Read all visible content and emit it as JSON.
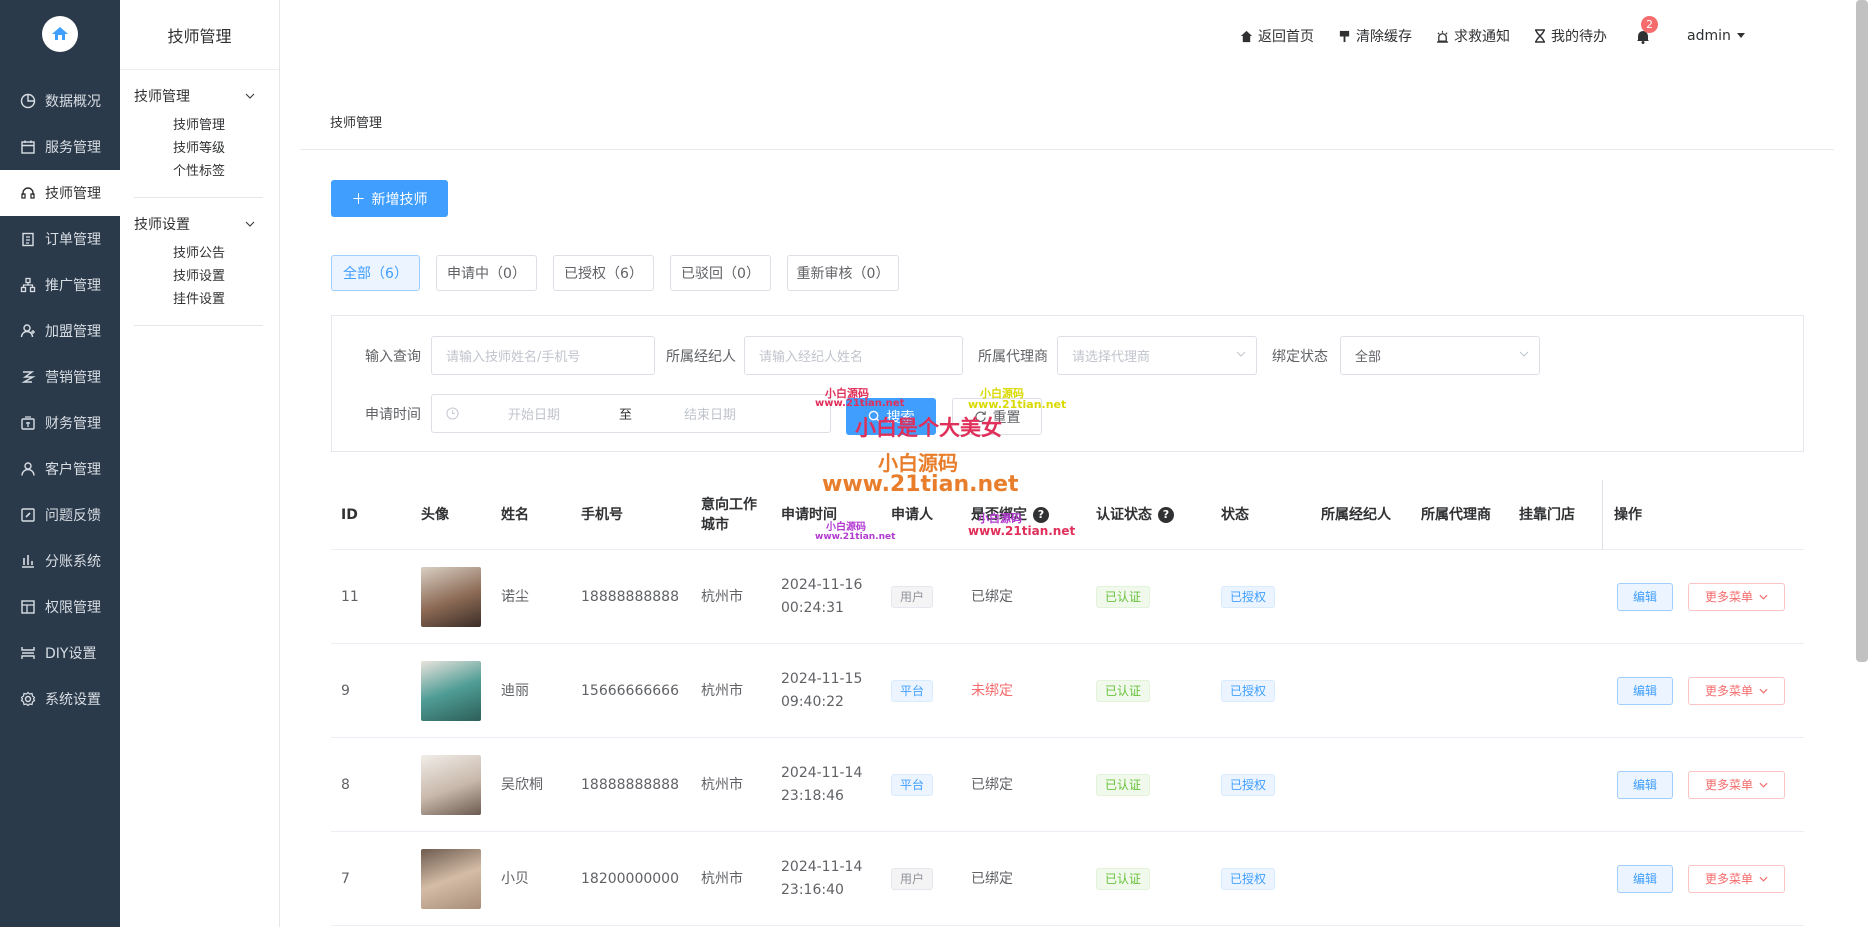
{
  "sidebar": {
    "items": [
      {
        "label": "数据概况",
        "icon": "pie-chart-icon"
      },
      {
        "label": "服务管理",
        "icon": "calendar-icon"
      },
      {
        "label": "技师管理",
        "icon": "headset-icon",
        "active": true
      },
      {
        "label": "订单管理",
        "icon": "clipboard-icon"
      },
      {
        "label": "推广管理",
        "icon": "share-icon"
      },
      {
        "label": "加盟管理",
        "icon": "users-icon"
      },
      {
        "label": "营销管理",
        "icon": "gift-icon"
      },
      {
        "label": "财务管理",
        "icon": "wallet-icon"
      },
      {
        "label": "客户管理",
        "icon": "user-icon"
      },
      {
        "label": "问题反馈",
        "icon": "edit-icon"
      },
      {
        "label": "分账系统",
        "icon": "bar-chart-icon"
      },
      {
        "label": "权限管理",
        "icon": "grid-icon"
      },
      {
        "label": "DIY设置",
        "icon": "layout-icon"
      },
      {
        "label": "系统设置",
        "icon": "gear-icon"
      }
    ]
  },
  "submenu": {
    "title": "技师管理",
    "groups": [
      {
        "label": "技师管理",
        "items": [
          "技师管理",
          "技师等级",
          "个性标签"
        ]
      },
      {
        "label": "技师设置",
        "items": [
          "技师公告",
          "技师设置",
          "挂件设置"
        ]
      }
    ]
  },
  "topbar": {
    "home": "返回首页",
    "clear_cache": "清除缓存",
    "sos": "求救通知",
    "todo": "我的待办",
    "notification_count": "2",
    "user": "admin"
  },
  "breadcrumb": "技师管理",
  "add_button": "新增技师",
  "tabs": [
    "全部（6）",
    "申请中（0）",
    "已授权（6）",
    "已驳回（0）",
    "重新审核（0）"
  ],
  "filter": {
    "query_label": "输入查询",
    "query_placeholder": "请输入技师姓名/手机号",
    "broker_label": "所属经纪人",
    "broker_placeholder": "请输入经纪人姓名",
    "agent_label": "所属代理商",
    "agent_placeholder": "请选择代理商",
    "bind_label": "绑定状态",
    "bind_value": "全部",
    "date_label": "申请时间",
    "start_placeholder": "开始日期",
    "date_sep": "至",
    "end_placeholder": "结束日期",
    "search_button": "搜索",
    "reset_button": "重置"
  },
  "table": {
    "headers": {
      "id": "ID",
      "avatar": "头像",
      "name": "姓名",
      "phone": "手机号",
      "city": "意向工作城市",
      "time": "申请时间",
      "applicant": "申请人",
      "bound": "是否绑定",
      "cert": "认证状态",
      "status": "状态",
      "broker": "所属经纪人",
      "agent": "所属代理商",
      "store": "挂靠门店",
      "ops": "操作"
    },
    "rows": [
      {
        "id": "11",
        "name": "诺尘",
        "phone": "18888888888",
        "city": "杭州市",
        "date": "2024-11-16",
        "time": "00:24:31",
        "applicant": "用户",
        "bound": "已绑定",
        "cert": "已认证",
        "status": "已授权"
      },
      {
        "id": "9",
        "name": "迪丽",
        "phone": "15666666666",
        "city": "杭州市",
        "date": "2024-11-15",
        "time": "09:40:22",
        "applicant": "平台",
        "bound": "未绑定",
        "cert": "已认证",
        "status": "已授权"
      },
      {
        "id": "8",
        "name": "吴欣桐",
        "phone": "18888888888",
        "city": "杭州市",
        "date": "2024-11-14",
        "time": "23:18:46",
        "applicant": "平台",
        "bound": "已绑定",
        "cert": "已认证",
        "status": "已授权"
      },
      {
        "id": "7",
        "name": "小贝",
        "phone": "18200000000",
        "city": "杭州市",
        "date": "2024-11-14",
        "time": "23:16:40",
        "applicant": "用户",
        "bound": "已绑定",
        "cert": "已认证",
        "status": "已授权"
      }
    ],
    "edit_button": "编辑",
    "more_button": "更多菜单"
  },
  "watermarks": [
    "小白源码",
    "www.21tian.net",
    "小白源码",
    "www.21tian.net",
    "小白是个大美女",
    "小白源码",
    "www.21tian.net",
    "小白源码",
    "www.21tian.net",
    "小白源码",
    "www.21tian.net"
  ]
}
